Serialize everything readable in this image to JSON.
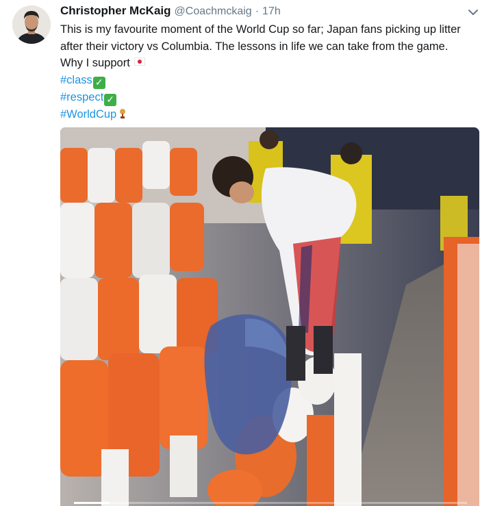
{
  "tweet": {
    "author": {
      "display_name": "Christopher McKaig",
      "handle": "@Coachmckaig",
      "separator": "·",
      "time": "17h"
    },
    "menu_icon": "chevron-down-icon",
    "text_lines": [
      "This is my favourite moment of the World Cup so far; Japan fans picking up litter",
      "after their victory vs Columbia. The lessons in life we can take from the game.",
      "Why I support"
    ],
    "hashtags": [
      "#class",
      "#respect",
      "#WorldCup"
    ],
    "emoji": {
      "flag": "japan-flag-icon",
      "check": "✓",
      "trophy": "trophy-icon"
    },
    "media": {
      "type": "video",
      "description_icon": "video-thumbnail",
      "progress": 0.09
    },
    "colors": {
      "link": "#1b95e0",
      "text": "#14171a",
      "secondary": "#657786",
      "check_bg": "#3fae49"
    }
  }
}
